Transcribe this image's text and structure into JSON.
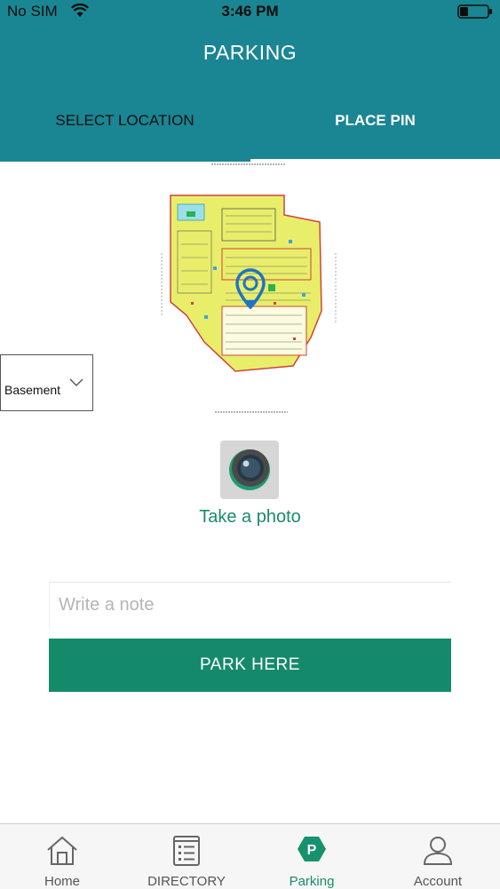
{
  "status_bar": {
    "carrier": "No SIM",
    "time": "3:46 PM"
  },
  "header": {
    "title": "PARKING",
    "tabs": [
      {
        "label": "SELECT LOCATION",
        "active": false
      },
      {
        "label": "PLACE PIN",
        "active": true
      }
    ]
  },
  "floor_selector": {
    "selected": "Basement",
    "icon": "chevron-down-icon"
  },
  "photo": {
    "label": "Take a photo",
    "icon": "camera-icon"
  },
  "note": {
    "placeholder": "Write a note",
    "value": ""
  },
  "park_button": {
    "label": "PARK HERE"
  },
  "bottom_nav": {
    "items": [
      {
        "label": "Home",
        "icon": "home-icon",
        "active": false
      },
      {
        "label": "DIRECTORY",
        "icon": "directory-icon",
        "active": false
      },
      {
        "label": "Parking",
        "icon": "parking-icon",
        "active": true
      },
      {
        "label": "Account",
        "icon": "account-icon",
        "active": false
      }
    ]
  },
  "colors": {
    "header_bg": "#1a8593",
    "accent_green": "#158a6b",
    "pin_blue": "#1e74c4",
    "map_fill": "#e8ee6a"
  }
}
